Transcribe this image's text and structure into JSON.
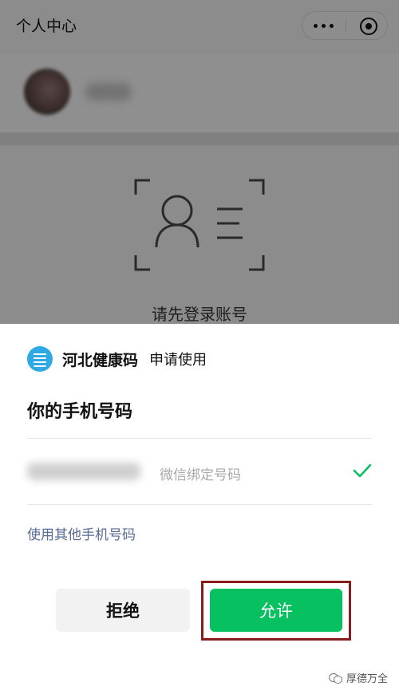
{
  "header": {
    "title": "个人中心",
    "menu_icon": "more-dots-icon",
    "close_icon": "target-circle-icon"
  },
  "profile": {
    "avatar_icon": "avatar-image",
    "nickname": ""
  },
  "login": {
    "prompt": "请先登录账号",
    "icon": "id-card-scan-icon"
  },
  "sheet": {
    "app_name": "河北健康码",
    "request_text": "申请使用",
    "heading": "你的手机号码",
    "phone_number": "",
    "phone_tag": "微信绑定号码",
    "selected_icon": "check-icon",
    "other_phone_link": "使用其他手机号码",
    "deny_label": "拒绝",
    "allow_label": "允许"
  },
  "watermark": {
    "text": "厚德万全",
    "icon": "wechat-icon"
  },
  "colors": {
    "allow_green": "#07c160",
    "link_blue": "#576b95",
    "highlight_red": "#8b1a1a",
    "overlay": "rgba(0,0,0,0.43)"
  }
}
